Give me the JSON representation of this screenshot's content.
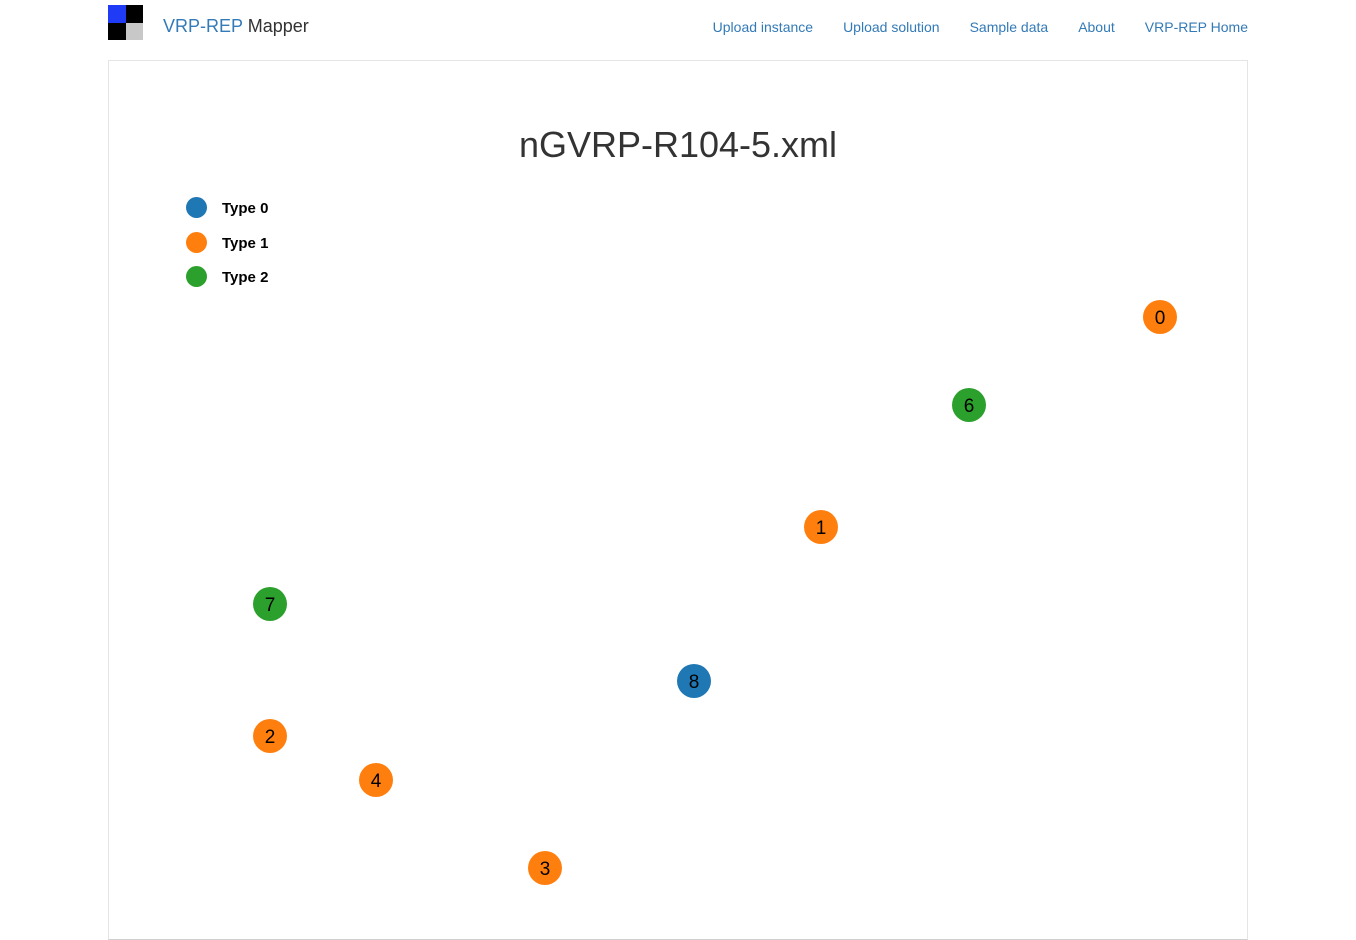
{
  "header": {
    "brand_part1": "VRP-REP",
    "brand_part2": "Mapper",
    "logo_colors": [
      "#1f3bf5",
      "#000000",
      "#000000",
      "#c8c8c8"
    ],
    "nav": [
      {
        "label": "Upload instance"
      },
      {
        "label": "Upload solution"
      },
      {
        "label": "Sample data"
      },
      {
        "label": "About"
      },
      {
        "label": "VRP-REP Home"
      }
    ]
  },
  "map": {
    "title": "nGVRP-R104-5.xml",
    "legend": [
      {
        "label": "Type 0",
        "color": "#1f77b4"
      },
      {
        "label": "Type 1",
        "color": "#ff7f0e"
      },
      {
        "label": "Type 2",
        "color": "#2ca02c"
      }
    ],
    "nodes": [
      {
        "label": "0",
        "type": 1
      },
      {
        "label": "1",
        "type": 1
      },
      {
        "label": "2",
        "type": 1
      },
      {
        "label": "3",
        "type": 1
      },
      {
        "label": "4",
        "type": 1
      },
      {
        "label": "6",
        "type": 2
      },
      {
        "label": "7",
        "type": 2
      },
      {
        "label": "8",
        "type": 0
      }
    ]
  }
}
